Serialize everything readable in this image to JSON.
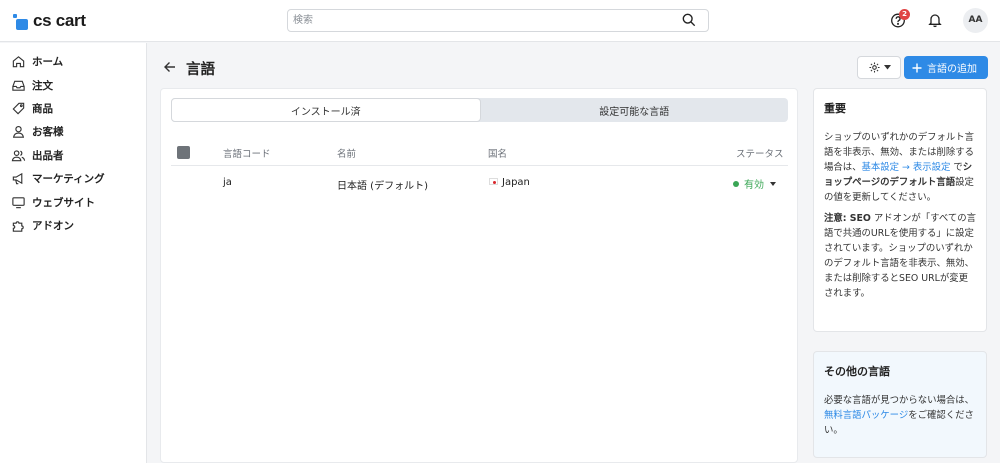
{
  "app": {
    "logo_text": "cs cart",
    "brand_color": "#2e8ae6"
  },
  "header": {
    "search_placeholder": "検索",
    "notification_count": "2",
    "avatar_initials": "AA"
  },
  "sidebar": {
    "items": [
      {
        "label": "ホーム",
        "icon": "home-icon"
      },
      {
        "label": "注文",
        "icon": "inbox-icon"
      },
      {
        "label": "商品",
        "icon": "tag-icon"
      },
      {
        "label": "お客様",
        "icon": "user-icon"
      },
      {
        "label": "出品者",
        "icon": "users-icon"
      },
      {
        "label": "マーケティング",
        "icon": "megaphone-icon"
      },
      {
        "label": "ウェブサイト",
        "icon": "monitor-icon"
      },
      {
        "label": "アドオン",
        "icon": "puzzle-icon"
      }
    ]
  },
  "page": {
    "title": "言語",
    "add_button_label": "言語の追加"
  },
  "tabs": [
    {
      "label": "インストール済",
      "active": true
    },
    {
      "label": "設定可能な言語",
      "active": false
    }
  ],
  "table": {
    "columns": [
      "言語コード",
      "名前",
      "国名",
      "ステータス"
    ],
    "rows": [
      {
        "code": "ja",
        "name": "日本語 (デフォルト)",
        "country": "Japan",
        "status": "有効"
      }
    ]
  },
  "important_card": {
    "title": "重要",
    "p1_before": "ショップのいずれかのデフォルト言語を非表示、無効、または削除する場合は、",
    "p1_link": "基本設定 → 表示設定",
    "p1_middle": " で",
    "p1_bold": "ショップページのデフォルト言語",
    "p1_after": "設定の値を更新してください。",
    "p2_bold": "注意: SEO",
    "p2_text": " アドオンが「すべての言語で共通のURLを使用する」に設定されています。ショップのいずれかのデフォルト言語を非表示、無効、または削除するとSEO URLが変更されます。"
  },
  "other_card": {
    "title": "その他の言語",
    "text_before": "必要な言語が見つからない場合は、",
    "link": "無料言語パッケージ",
    "text_after": "をご確認ください。"
  }
}
